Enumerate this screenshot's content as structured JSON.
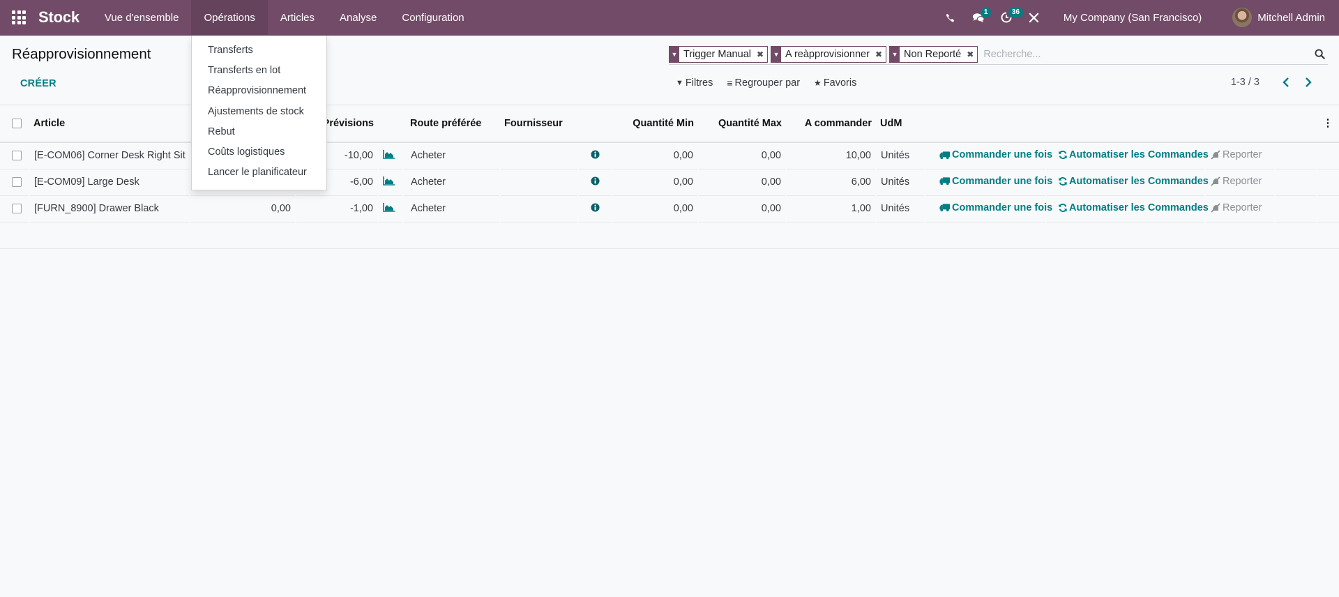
{
  "navbar": {
    "app_name": "Stock",
    "menu": [
      {
        "label": "Vue d'ensemble",
        "active": false
      },
      {
        "label": "Opérations",
        "active": true
      },
      {
        "label": "Articles",
        "active": false
      },
      {
        "label": "Analyse",
        "active": false
      },
      {
        "label": "Configuration",
        "active": false
      }
    ],
    "messages_badge": "1",
    "activities_badge": "36",
    "company": "My Company (San Francisco)",
    "user": "Mitchell Admin"
  },
  "operations_menu": {
    "items": [
      "Transferts",
      "Transferts en lot",
      "Réapprovisionnement",
      "Ajustements de stock",
      "Rebut",
      "Coûts logistiques",
      "Lancer le planificateur"
    ]
  },
  "page": {
    "title": "Réapprovisionnement",
    "create_label": "CRÉER"
  },
  "search": {
    "facets": [
      "Trigger Manual",
      "A reàpprovisionner",
      "Non Reporté"
    ],
    "placeholder": "Recherche..."
  },
  "filters": {
    "filters_label": "Filtres",
    "group_by_label": "Regrouper par",
    "favorites_label": "Favoris"
  },
  "pager": {
    "value": "1-3 / 3"
  },
  "table": {
    "columns": {
      "article": "Article",
      "forecast": "Prévisions",
      "route": "Route préférée",
      "supplier": "Fournisseur",
      "min_qty": "Quantité Min",
      "max_qty": "Quantité Max",
      "to_order": "A commander",
      "uom": "UdM"
    },
    "actions": {
      "order_once": "Commander une fois",
      "automate": "Automatiser les Commandes",
      "snooze": "Reporter"
    },
    "rows": [
      {
        "article": "[E-COM06] Corner Desk Right Sit",
        "on_hand": "",
        "forecast": "-10,00",
        "route": "Acheter",
        "supplier": "",
        "min_qty": "0,00",
        "max_qty": "0,00",
        "to_order": "10,00",
        "uom": "Unités"
      },
      {
        "article": "[E-COM09] Large Desk",
        "on_hand": "",
        "forecast": "-6,00",
        "route": "Acheter",
        "supplier": "",
        "min_qty": "0,00",
        "max_qty": "0,00",
        "to_order": "6,00",
        "uom": "Unités"
      },
      {
        "article": "[FURN_8900] Drawer Black",
        "on_hand": "0,00",
        "forecast": "-1,00",
        "route": "Acheter",
        "supplier": "",
        "min_qty": "0,00",
        "max_qty": "0,00",
        "to_order": "1,00",
        "uom": "Unités"
      }
    ]
  },
  "colors": {
    "brand": "#714b67",
    "accent": "#017e84"
  }
}
